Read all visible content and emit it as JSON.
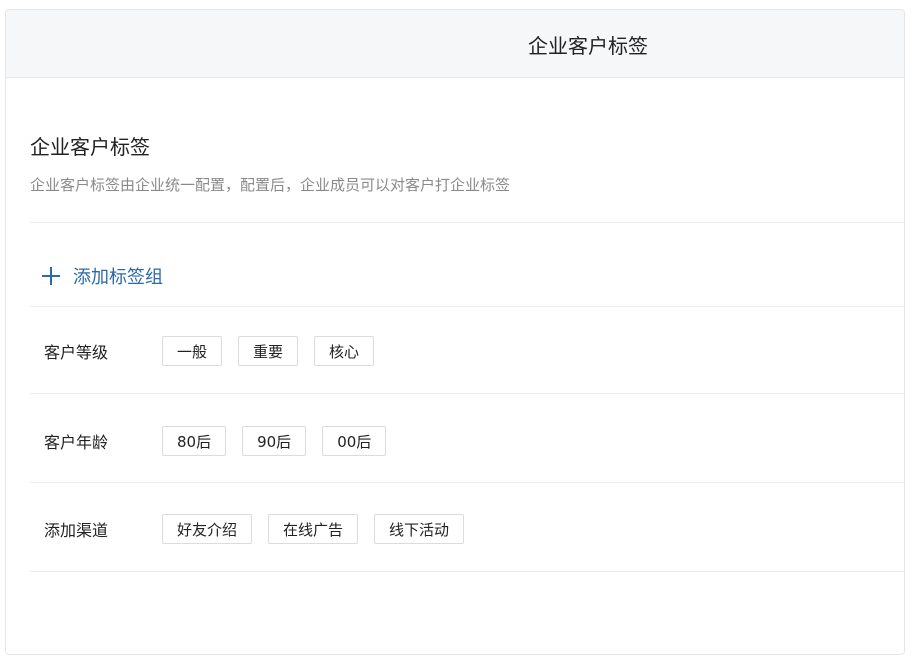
{
  "window": {
    "title": "企业客户标签"
  },
  "page": {
    "heading": "企业客户标签",
    "description": "企业客户标签由企业统一配置，配置后，企业成员可以对客户打企业标签",
    "add_group_label": "添加标签组"
  },
  "tag_groups": [
    {
      "name": "客户等级",
      "tags": [
        "一般",
        "重要",
        "核心"
      ]
    },
    {
      "name": "客户年龄",
      "tags": [
        "80后",
        "90后",
        "00后"
      ]
    },
    {
      "name": "添加渠道",
      "tags": [
        "好友介绍",
        "在线广告",
        "线下活动"
      ]
    }
  ],
  "colors": {
    "accent": "#2b6aa6",
    "titlebar_bg": "#f6f7f9",
    "description_text": "#8a8a8a",
    "border": "#dcdcdc"
  },
  "icons": {
    "add": "plus-icon"
  }
}
